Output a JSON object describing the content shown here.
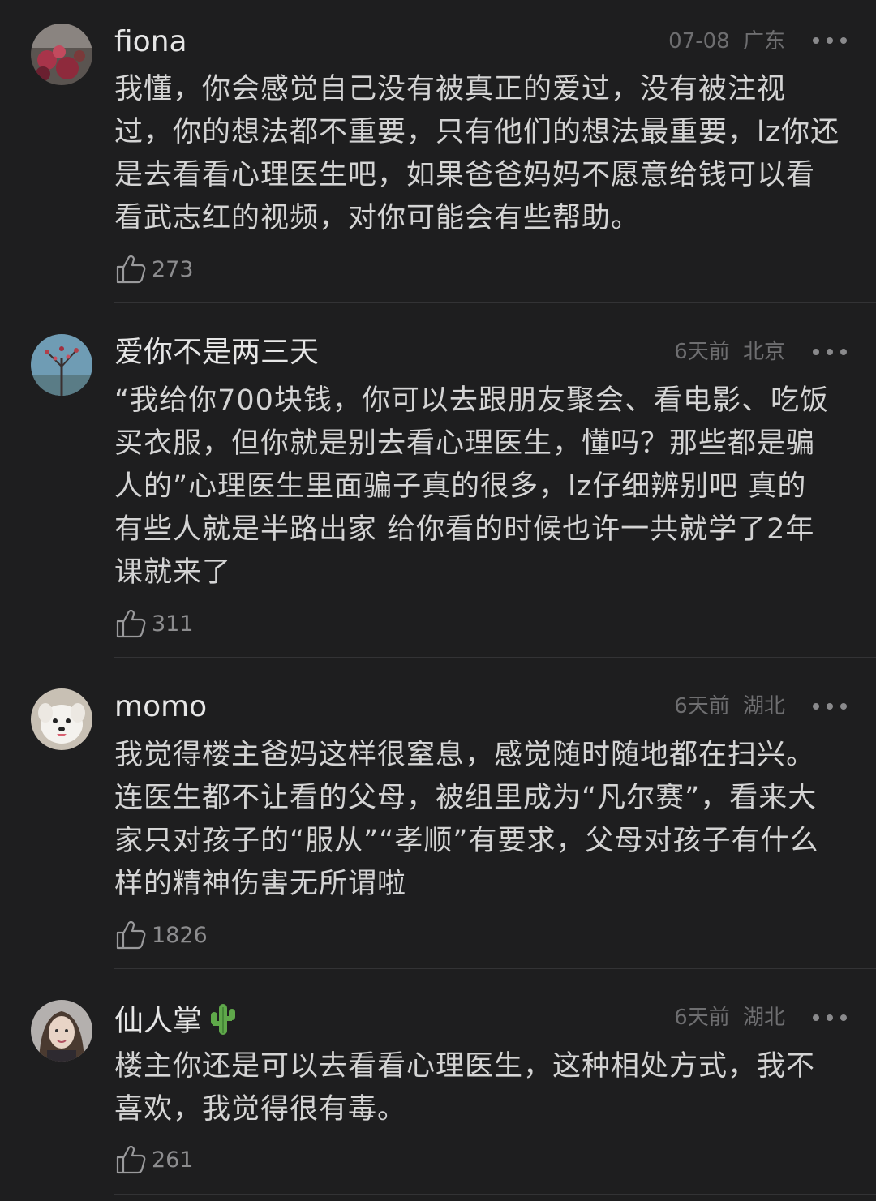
{
  "comments": [
    {
      "username": "fiona",
      "date": "07-08",
      "location": "广东",
      "text": "我懂，你会感觉自己没有被真正的爱过，没有被注视过，你的想法都不重要，只有他们的想法最重要，lz你还是去看看心理医生吧，如果爸爸妈妈不愿意给钱可以看看武志红的视频，对你可能会有些帮助。",
      "likes": "273",
      "avatar_icon": "avatar-flowers-icon"
    },
    {
      "username": "爱你不是两三天",
      "date": "6天前",
      "location": "北京",
      "text": "“我给你700块钱，你可以去跟朋友聚会、看电影、吃饭买衣服，但你就是别去看心理医生，懂吗？那些都是骗人的”心理医生里面骗子真的很多，lz仔细辨别吧 真的 有些人就是半路出家 给你看的时候也许一共就学了2年课就来了",
      "likes": "311",
      "avatar_icon": "avatar-tree-icon"
    },
    {
      "username": "momo",
      "date": "6天前",
      "location": "湖北",
      "text": "我觉得楼主爸妈这样很窒息，感觉随时随地都在扫兴。连医生都不让看的父母，被组里成为“凡尔赛”，看来大家只对孩子的“服从”“孝顺”有要求，父母对孩子有什么样的精神伤害无所谓啦",
      "likes": "1826",
      "avatar_icon": "avatar-dog-icon"
    },
    {
      "username": "仙人掌",
      "date": "6天前",
      "location": "湖北",
      "text": "楼主你还是可以去看看心理医生，这种相处方式，我不喜欢，我觉得很有毒。",
      "likes": "261",
      "avatar_icon": "avatar-portrait-icon",
      "emoji": "cactus-emoji"
    }
  ],
  "colors": {
    "background": "#1e1e1f",
    "text": "#d4d4d4",
    "meta": "#6e6e70",
    "divider": "#333335"
  }
}
